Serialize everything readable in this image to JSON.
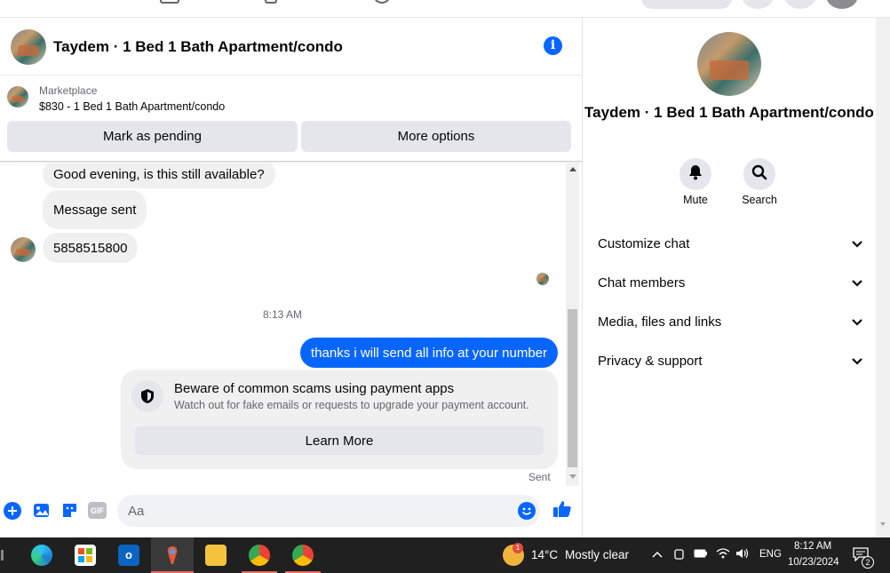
{
  "header": {
    "title": "Taydem · 1 Bed 1 Bath Apartment/condo"
  },
  "marketplace": {
    "label": "Marketplace",
    "listing": "$830 - 1 Bed 1 Bath Apartment/condo",
    "mark_pending": "Mark as pending",
    "more_options": "More options"
  },
  "messages": {
    "incoming": [
      "Good evening, is this still available?",
      "Message sent",
      "5858515800"
    ],
    "timestamp": "8:13 AM",
    "outgoing": "thanks i will send all info at your number",
    "sent_label": "Sent"
  },
  "scam_notice": {
    "title": "Beware of common scams using payment apps",
    "subtitle": "Watch out for fake emails or requests to upgrade your payment account.",
    "button": "Learn More"
  },
  "composer": {
    "placeholder": "Aa",
    "gif_label": "GIF"
  },
  "details": {
    "title": "Taydem · 1 Bed 1 Bath Apartment/condo",
    "mute_label": "Mute",
    "search_label": "Search",
    "sections": [
      "Customize chat",
      "Chat members",
      "Media, files and links",
      "Privacy & support"
    ]
  },
  "taskbar": {
    "weather_temp": "14°C",
    "weather_desc": "Mostly clear",
    "weather_badge": "1",
    "language": "ENG",
    "time": "8:12 AM",
    "date": "10/23/2024",
    "notification_count": "2"
  },
  "colors": {
    "accent": "#0866ff",
    "bubble_in": "#f0f0f0",
    "taskbar": "#202020"
  }
}
